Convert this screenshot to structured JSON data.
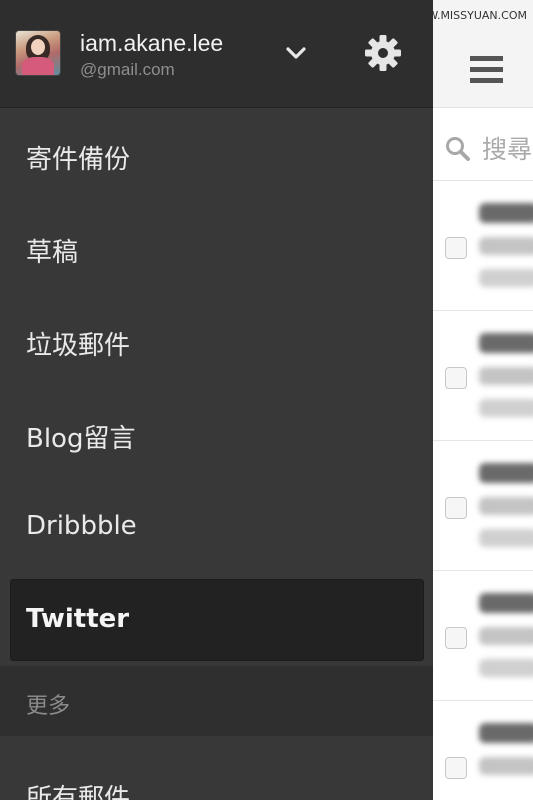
{
  "watermark": "思缘设计论坛 WWW.MISSYUAN.COM",
  "account": {
    "name": "iam.akane.lee",
    "email": "@gmail.com"
  },
  "nav": {
    "items": [
      {
        "label": "寄件備份"
      },
      {
        "label": "草稿"
      },
      {
        "label": "垃圾郵件"
      },
      {
        "label": "Blog留言"
      },
      {
        "label": "Dribbble"
      },
      {
        "label": "Twitter",
        "active": true
      }
    ],
    "section_header": "更多",
    "more_items": [
      {
        "label": "所有郵件"
      }
    ]
  },
  "search": {
    "placeholder": "搜尋"
  },
  "icons": {
    "chevron": "chevron-down-icon",
    "settings": "gear-icon",
    "menu": "hamburger-menu-icon",
    "search": "search-icon"
  },
  "colors": {
    "drawer_bg": "#383838",
    "account_bg": "#2e2e2e",
    "active_item_bg": "#222222",
    "section_bg": "#2f2f2f"
  }
}
